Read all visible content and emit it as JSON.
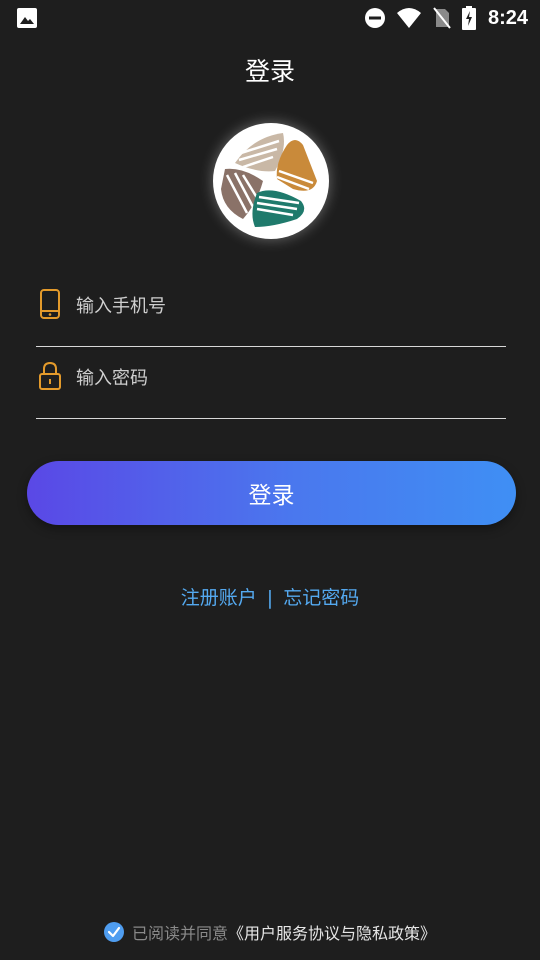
{
  "status_bar": {
    "time": "8:24",
    "icons": [
      "gallery-icon",
      "do-not-disturb-icon",
      "wifi-icon",
      "no-sim-icon",
      "battery-charging-icon"
    ]
  },
  "header": {
    "title": "登录"
  },
  "logo": {
    "icon": "app-logo-icon",
    "colors": [
      "#c9b8a6",
      "#c98a3a",
      "#8a7268",
      "#1f7a6c"
    ]
  },
  "form": {
    "phone": {
      "icon": "phone-icon",
      "placeholder": "输入手机号",
      "value": ""
    },
    "password": {
      "icon": "lock-icon",
      "placeholder": "输入密码",
      "value": ""
    },
    "login_button_label": "登录"
  },
  "links": {
    "register": "注册账户",
    "separator": "|",
    "forgot": "忘记密码"
  },
  "agreement": {
    "checked": true,
    "prefix": "已阅读并同意",
    "policy": "《用户服务协议与隐私政策》"
  },
  "colors": {
    "background": "#1e1e1e",
    "accent_icon": "#e39a2b",
    "link": "#54a9f0",
    "button_gradient_start": "#5a48e6",
    "button_gradient_end": "#3f8ff4"
  }
}
